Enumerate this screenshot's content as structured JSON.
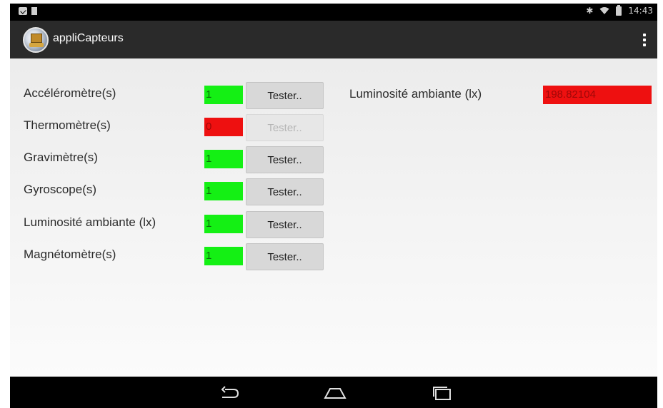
{
  "status_bar": {
    "left_icons": [
      "notification-icon",
      "sim-icon"
    ],
    "right_icons": [
      "bluetooth-icon",
      "wifi-icon",
      "battery-icon"
    ],
    "time": "14:43"
  },
  "action_bar": {
    "app_icon": "app-logo-icon",
    "title": "appliCapteurs",
    "overflow_icon": "overflow-menu-icon"
  },
  "sensors": [
    {
      "label": "Accéléromètre(s)",
      "count": "1",
      "status": "ok",
      "button": "Tester..",
      "enabled": true
    },
    {
      "label": "Thermomètre(s)",
      "count": "0",
      "status": "ko",
      "button": "Tester..",
      "enabled": false
    },
    {
      "label": "Gravimètre(s)",
      "count": "1",
      "status": "ok",
      "button": "Tester..",
      "enabled": true
    },
    {
      "label": "Gyroscope(s)",
      "count": "1",
      "status": "ok",
      "button": "Tester..",
      "enabled": true
    },
    {
      "label": "Luminosité ambiante (lx)",
      "count": "1",
      "status": "ok",
      "button": "Tester..",
      "enabled": true
    },
    {
      "label": "Magnétomètre(s)",
      "count": "1",
      "status": "ok",
      "button": "Tester..",
      "enabled": true
    }
  ],
  "luminosity_panel": {
    "label": "Luminosité ambiante (lx)",
    "value": "198.82104"
  },
  "colors": {
    "ok": "#14f014",
    "ko": "#ee1010",
    "action_bar": "#2a2a2a"
  },
  "nav_bar": {
    "buttons": [
      "back-icon",
      "home-icon",
      "recents-icon"
    ]
  }
}
